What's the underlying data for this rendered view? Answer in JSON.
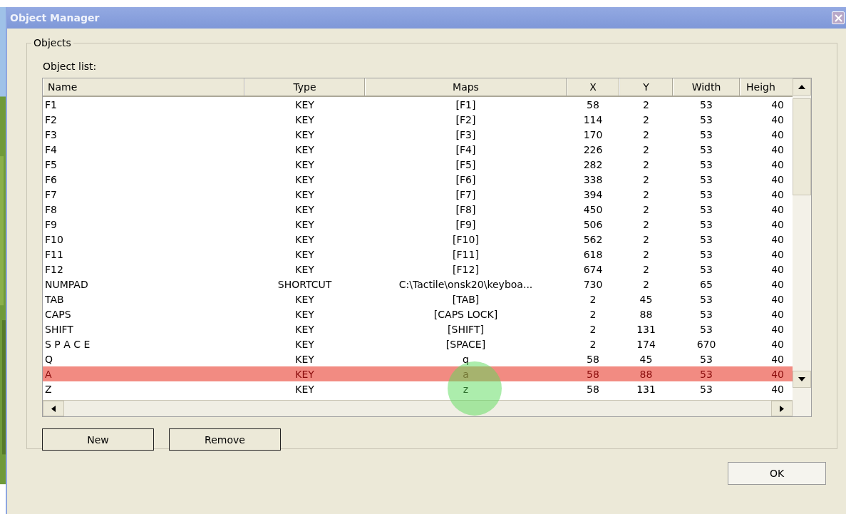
{
  "window": {
    "title": "Object Manager"
  },
  "group": {
    "title": "Objects",
    "list_label": "Object list:"
  },
  "table": {
    "columns": [
      "Name",
      "Type",
      "Maps",
      "X",
      "Y",
      "Width",
      "Heigh"
    ],
    "rows": [
      {
        "cells": [
          "F1",
          "KEY",
          "[F1]",
          "58",
          "2",
          "53",
          "40"
        ],
        "selected": false
      },
      {
        "cells": [
          "F2",
          "KEY",
          "[F2]",
          "114",
          "2",
          "53",
          "40"
        ],
        "selected": false
      },
      {
        "cells": [
          "F3",
          "KEY",
          "[F3]",
          "170",
          "2",
          "53",
          "40"
        ],
        "selected": false
      },
      {
        "cells": [
          "F4",
          "KEY",
          "[F4]",
          "226",
          "2",
          "53",
          "40"
        ],
        "selected": false
      },
      {
        "cells": [
          "F5",
          "KEY",
          "[F5]",
          "282",
          "2",
          "53",
          "40"
        ],
        "selected": false
      },
      {
        "cells": [
          "F6",
          "KEY",
          "[F6]",
          "338",
          "2",
          "53",
          "40"
        ],
        "selected": false
      },
      {
        "cells": [
          "F7",
          "KEY",
          "[F7]",
          "394",
          "2",
          "53",
          "40"
        ],
        "selected": false
      },
      {
        "cells": [
          "F8",
          "KEY",
          "[F8]",
          "450",
          "2",
          "53",
          "40"
        ],
        "selected": false
      },
      {
        "cells": [
          "F9",
          "KEY",
          "[F9]",
          "506",
          "2",
          "53",
          "40"
        ],
        "selected": false
      },
      {
        "cells": [
          "F10",
          "KEY",
          "[F10]",
          "562",
          "2",
          "53",
          "40"
        ],
        "selected": false
      },
      {
        "cells": [
          "F11",
          "KEY",
          "[F11]",
          "618",
          "2",
          "53",
          "40"
        ],
        "selected": false
      },
      {
        "cells": [
          "F12",
          "KEY",
          "[F12]",
          "674",
          "2",
          "53",
          "40"
        ],
        "selected": false
      },
      {
        "cells": [
          "NUMPAD",
          "SHORTCUT",
          "C:\\Tactile\\onsk20\\keyboa...",
          "730",
          "2",
          "65",
          "40"
        ],
        "selected": false
      },
      {
        "cells": [
          "TAB",
          "KEY",
          "[TAB]",
          "2",
          "45",
          "53",
          "40"
        ],
        "selected": false
      },
      {
        "cells": [
          "CAPS",
          "KEY",
          "[CAPS LOCK]",
          "2",
          "88",
          "53",
          "40"
        ],
        "selected": false
      },
      {
        "cells": [
          "SHIFT",
          "KEY",
          "[SHIFT]",
          "2",
          "131",
          "53",
          "40"
        ],
        "selected": false
      },
      {
        "cells": [
          "S P A C E",
          "KEY",
          "[SPACE]",
          "2",
          "174",
          "670",
          "40"
        ],
        "selected": false
      },
      {
        "cells": [
          "Q",
          "KEY",
          "q",
          "58",
          "45",
          "53",
          "40"
        ],
        "selected": false
      },
      {
        "cells": [
          "A",
          "KEY",
          "a",
          "58",
          "88",
          "53",
          "40"
        ],
        "selected": true
      },
      {
        "cells": [
          "Z",
          "KEY",
          "z",
          "58",
          "131",
          "53",
          "40"
        ],
        "selected": false
      }
    ]
  },
  "buttons": [
    "New",
    "Remove"
  ],
  "ok_button": "OK"
}
